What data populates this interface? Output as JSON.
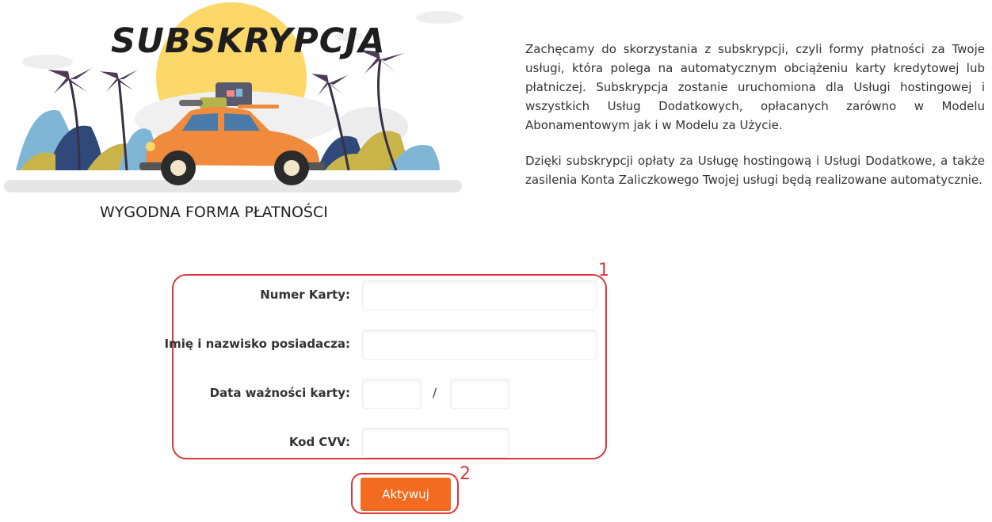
{
  "banner": {
    "title": "SUBSKRYPCJA",
    "subtitle": "WYGODNA FORMA PŁATNOŚCI"
  },
  "description": {
    "paragraph1": "Zachęcamy do skorzystania z subskrypcji, czyli formy płatności za Twoje usługi, która polega na automatycznym obciążeniu karty kredytowej lub płatniczej. Subskrypcja zostanie uruchomiona dla Usługi hostingowej i wszystkich Usług Dodatkowych, opłacanych zarówno w Modelu Abonamentowym jak i w Modelu za Użycie.",
    "paragraph2": "Dzięki subskrypcji opłaty za Usługę hostingową i Usługi Dodatkowe, a także zasilenia Konta Zaliczkowego Twojej usługi będą realizowane automatycznie."
  },
  "form": {
    "card_number_label": "Numer Karty:",
    "card_number_value": "",
    "holder_label": "Imię i nazwisko posiadacza:",
    "holder_value": "",
    "expiry_label": "Data ważności karty:",
    "expiry_month_value": "",
    "expiry_separator": "/",
    "expiry_year_value": "",
    "cvv_label": "Kod CVV:",
    "cvv_value": ""
  },
  "annotations": {
    "form_marker": "1",
    "button_marker": "2"
  },
  "actions": {
    "activate_label": "Aktywuj"
  },
  "colors": {
    "accent": "#f36b21",
    "annotation": "#d9363e",
    "car": "#f08a3c",
    "sun": "#fcd86a"
  },
  "icons": {
    "banner_illustration": "car-with-luggage-palm-trees-illustration"
  }
}
